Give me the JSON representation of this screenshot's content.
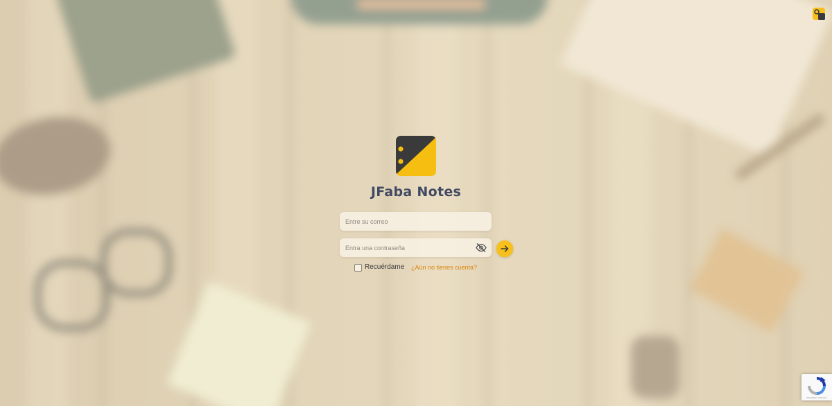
{
  "app": {
    "title": "JFaba Notes"
  },
  "login_form": {
    "email_placeholder": "Entre su correo",
    "password_placeholder": "Entra una contraseña",
    "remember_label": "Recuérdame",
    "remember_checked": false,
    "signup_link": "¿Aún no tienes cuenta?"
  },
  "icons": {
    "app_logo": "notebook-logo-icon",
    "corner_logo": "jfaba-logo-icon",
    "password_visibility": "eye-off-icon",
    "submit": "arrow-right-icon",
    "recaptcha": "recaptcha-icon"
  },
  "recaptcha": {
    "label": "Privacidad - Términos"
  },
  "colors": {
    "brand_yellow": "#f7c01c",
    "brand_dark": "#3a3a3a",
    "title": "#414a63",
    "link": "#d9860c"
  }
}
